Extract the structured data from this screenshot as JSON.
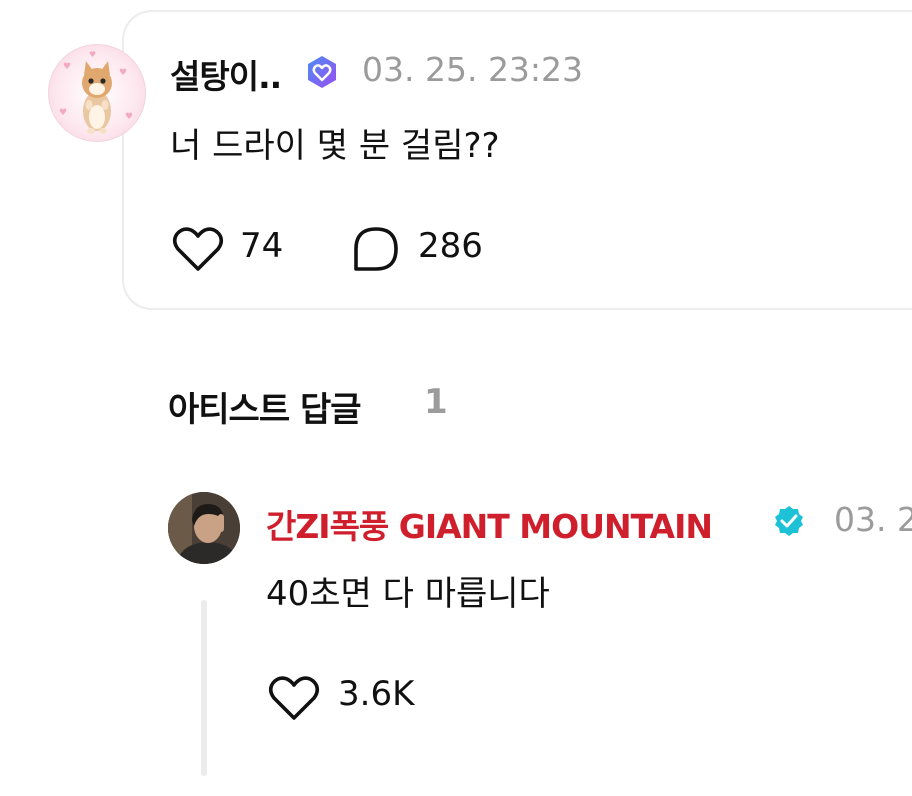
{
  "post": {
    "username": "설탕이..",
    "badge_icon": "verified-heart-icon",
    "timestamp": "03. 25. 23:23",
    "text": "너 드라이 몇 분 걸림??",
    "likes": "74",
    "comments": "286",
    "like_icon": "heart-icon",
    "comment_icon": "chat-bubble-icon"
  },
  "section": {
    "title": "아티스트 답글",
    "count": "1"
  },
  "reply": {
    "username": "간ZI폭풍 GIANT MOUNTAIN",
    "badge_icon": "verified-check-icon",
    "timestamp": "03. 2",
    "text": "40초면 다 마릅니다",
    "likes": "3.6K",
    "like_icon": "heart-icon"
  },
  "colors": {
    "artist_name": "#cf1f2c",
    "verified_teal": "#1ec2d6",
    "verified_purple": "#7b5cf0",
    "muted": "#9b9b9b"
  }
}
